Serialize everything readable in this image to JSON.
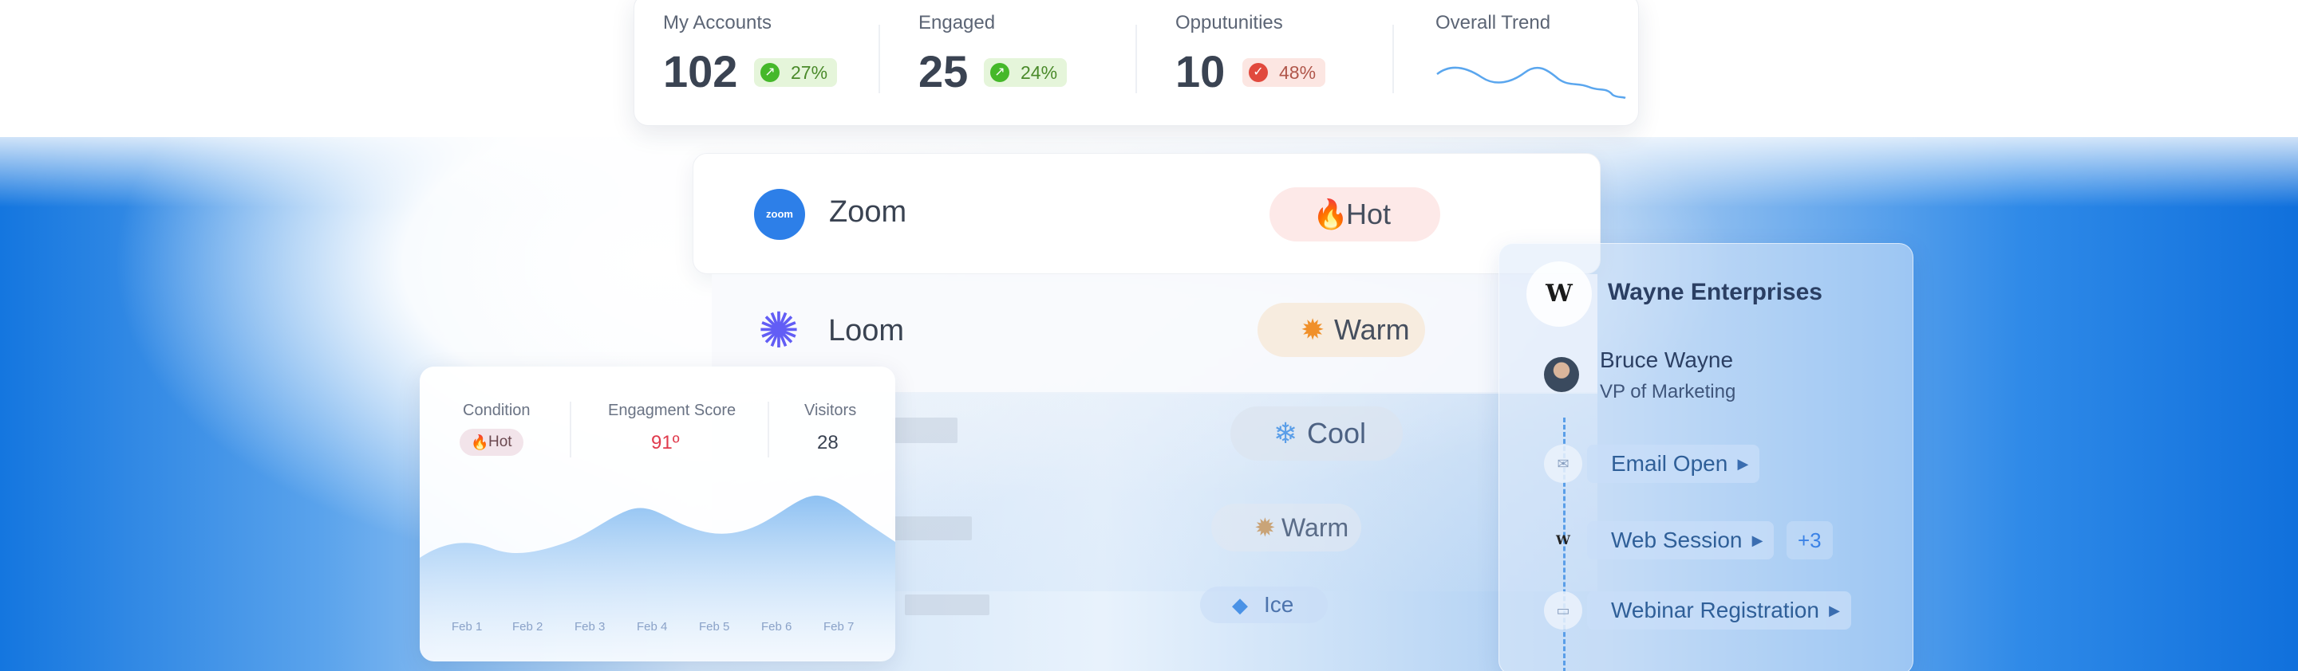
{
  "stats": {
    "my_accounts": {
      "label": "My Accounts",
      "value": "102",
      "change": "27%",
      "direction": "up"
    },
    "engaged": {
      "label": "Engaged",
      "value": "25",
      "change": "24%",
      "direction": "up"
    },
    "opportunities": {
      "label": "Opputunities",
      "value": "10",
      "change": "48%",
      "direction": "down"
    },
    "trend": {
      "label": "Overall Trend"
    }
  },
  "accounts": [
    {
      "name": "Zoom",
      "temperature": "Hot",
      "icon": "flame-icon",
      "tag_color": "#fde9e8"
    },
    {
      "name": "Loom",
      "temperature": "Warm",
      "icon": "sun-icon",
      "tag_color": "#f7ecdf"
    },
    {
      "name": "",
      "temperature": "Cool",
      "icon": "snowflake-icon"
    },
    {
      "name": "",
      "temperature": "Warm",
      "icon": "sun-icon"
    },
    {
      "name": "",
      "temperature": "Ice",
      "icon": "ice-cube-icon"
    }
  ],
  "condition_card": {
    "condition_label": "Condition",
    "condition_value": "Hot",
    "score_label": "Engagment Score",
    "score_value": "91º",
    "visitors_label": "Visitors",
    "visitors_value": "28",
    "x_labels": [
      "Feb 1",
      "Feb 2",
      "Feb 3",
      "Feb 4",
      "Feb 5",
      "Feb 6",
      "Feb 7"
    ]
  },
  "wayne": {
    "company": "Wayne Enterprises",
    "logo_glyph": "W",
    "person_name": "Bruce Wayne",
    "person_role": "VP of Marketing",
    "activities": [
      {
        "label": "Email Open",
        "icon": "envelope-icon"
      },
      {
        "label": "Web Session",
        "icon": "wayne-logo-icon",
        "extra": "+3"
      },
      {
        "label": "Webinar Registration",
        "icon": "monitor-icon"
      }
    ]
  },
  "colors": {
    "accent_blue": "#1070dc",
    "hot": "#e04a4a",
    "warm": "#f0902a",
    "cool": "#5a9ee8",
    "up": "#45b82a",
    "down": "#e1493d"
  }
}
